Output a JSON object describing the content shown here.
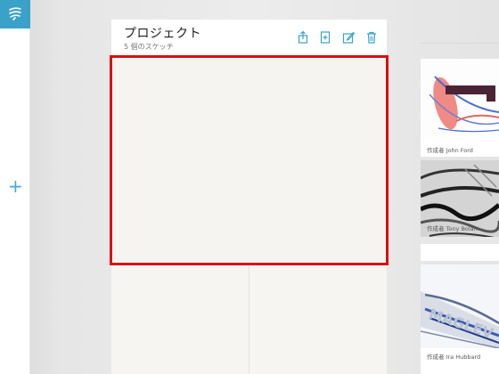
{
  "sidebar": {
    "logo_icon": "app-logo-icon",
    "add_icon_glyph": "+"
  },
  "project": {
    "title": "プロジェクト",
    "subtitle": "5 個のスケッチ",
    "toolbar": [
      {
        "name": "share-icon"
      },
      {
        "name": "new-sketch-icon"
      },
      {
        "name": "edit-icon"
      },
      {
        "name": "trash-icon"
      }
    ]
  },
  "gallery": {
    "items": [
      {
        "author": "作成者 John Ford"
      },
      {
        "author": "作成者 Tony Bolan"
      },
      {
        "author": "作成者 Ira Hubbard"
      }
    ]
  },
  "colors": {
    "accent": "#3aa2c9",
    "selection": "#e00d0d"
  }
}
